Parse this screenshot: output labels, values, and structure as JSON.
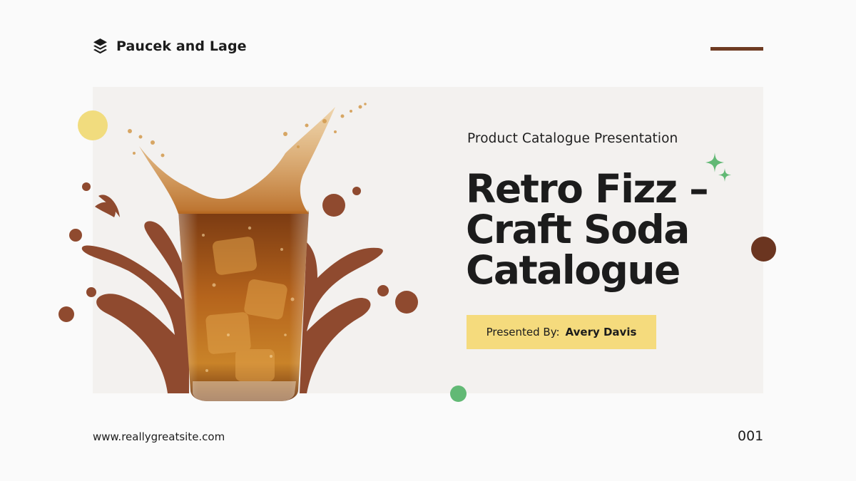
{
  "header": {
    "brand_name": "Paucek and Lage",
    "brand_icon": "stacked-layers-icon"
  },
  "hero": {
    "subtitle": "Product Catalogue Presentation",
    "title_lines": [
      "Retro Fizz –",
      "Craft Soda",
      "Catalogue"
    ],
    "presenter_label": "Presented By:",
    "presenter_name": "Avery Davis"
  },
  "footer": {
    "website": "www.reallygreatsite.com",
    "page_number": "001"
  },
  "colors": {
    "background": "#fafafa",
    "card": "#f3f1ef",
    "brown_dark": "#6b3520",
    "brown_splash": "#8f4a2f",
    "yellow": "#f5db7d",
    "green": "#62b975"
  },
  "icons": [
    "stacked-layers-icon",
    "sparkle-icon",
    "soda-glass-splash-image"
  ]
}
